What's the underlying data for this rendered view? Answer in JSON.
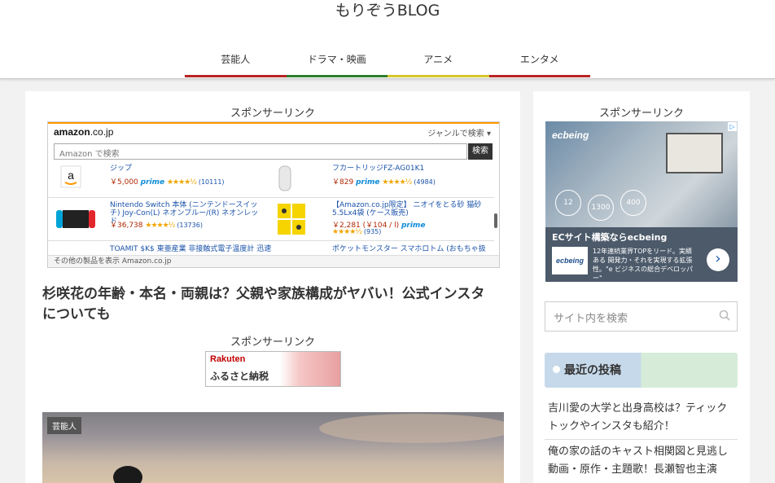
{
  "site": {
    "title": "もりぞうBLOG"
  },
  "nav": {
    "items": [
      {
        "label": "芸能人",
        "color": "#b72424"
      },
      {
        "label": "ドラマ・映画",
        "color": "#2e7d2e"
      },
      {
        "label": "アニメ",
        "color": "#d4c82a"
      },
      {
        "label": "エンタメ",
        "color": "#b72424"
      }
    ]
  },
  "main": {
    "sponsor_label_top": "スポンサーリンク",
    "sponsor_label_mid": "スポンサーリンク",
    "post_title": "杉咲花の年齢・本名・両親は？父親や家族構成がヤバい！公式インスタについても",
    "category_badge": "芸能人",
    "rakuten": {
      "brand": "Rakuten",
      "text": "ふるさと納税"
    }
  },
  "amazon_widget": {
    "logo": "amazon",
    "logo_tld": ".co.jp",
    "genre_label": "ジャンルで検索",
    "search_placeholder": "Amazon で検索",
    "search_button": "検索",
    "footer": "その他の製品を表示 Amazon.co.jp",
    "products": [
      {
        "title": "ジップ",
        "price": "￥5,000",
        "prime": "prime",
        "stars": "★★★★½",
        "count": "(10111)"
      },
      {
        "title": "フカートリッジFZ-AG01K1",
        "price": "￥829",
        "prime": "prime",
        "stars": "★★★★½",
        "count": "(4984)"
      },
      {
        "title": "Nintendo Switch 本体 (ニンテンドースイッチ) Joy-Con(L) ネオンブルー/(R) ネオンレッド",
        "price": "￥36,738",
        "prime": "",
        "stars": "★★★★½",
        "count": "(13736)"
      },
      {
        "title": "【Amazon.co.jp限定】 ニオイをとる砂 猫砂 5.5Lx4袋 (ケース販売)",
        "price": "￥2,281 (￥104 / l)",
        "prime": "prime",
        "stars": "★★★★½",
        "count": "(935)"
      },
      {
        "title": "TOAMIT $K$ 東亜産業 非接触式電子温度計 迅速",
        "price": "",
        "prime": "",
        "stars": "",
        "count": ""
      },
      {
        "title": "ポケットモンスター スマホロトム (おもちゃ扱",
        "price": "",
        "prime": "",
        "stars": "",
        "count": ""
      }
    ]
  },
  "sidebar": {
    "sponsor_label": "スポンサーリンク",
    "ad": {
      "brand": "ecbeing",
      "headline": "ECサイト構築ならecbeing",
      "body": "12年連続業界TOPをリード。実績ある 開発力・それを実現する拡張性。\"e ビジネスの総合デベロッパー\"",
      "stats": [
        "12",
        "1300",
        "400"
      ]
    },
    "search_placeholder": "サイト内を検索",
    "recent_title": "最近の投稿",
    "recent_posts": [
      "吉川愛の大学と出身高校は？ティックトックやインスタも紹介！",
      "俺の家の話のキャスト相関図と見逃し動画・原作・主題歌！長瀬智也主演"
    ]
  }
}
